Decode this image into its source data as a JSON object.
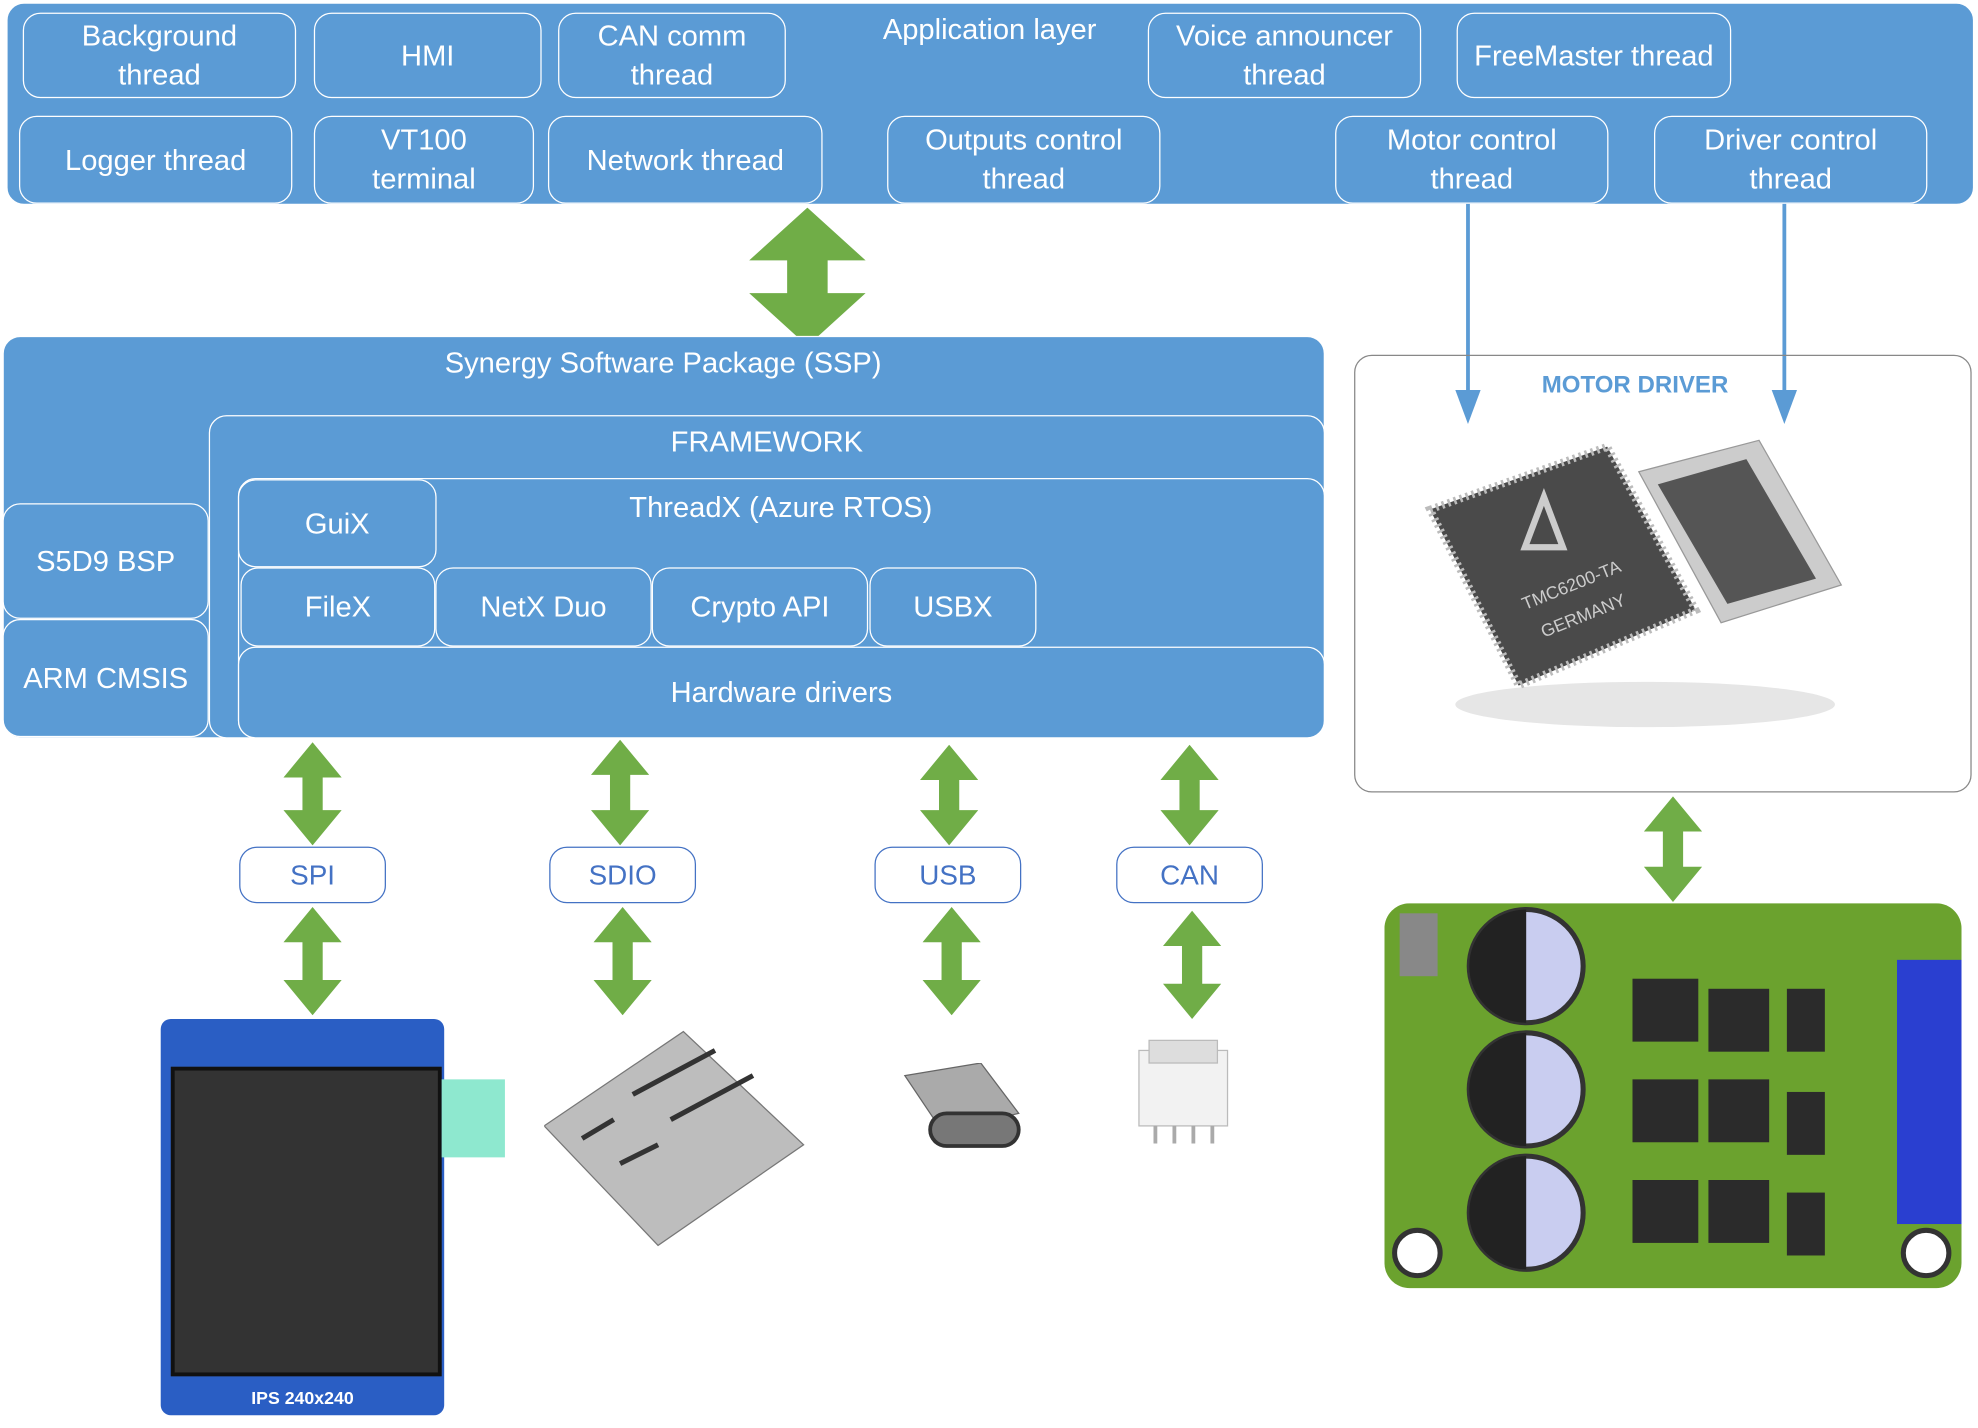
{
  "application_layer": {
    "title": "Application layer",
    "threads": [
      "Background thread",
      "HMI",
      "CAN comm thread",
      "Voice announcer thread",
      "FreeMaster thread",
      "Logger thread",
      "VT100 terminal",
      "Network thread",
      "Outputs control thread",
      "Motor control thread",
      "Driver control thread"
    ]
  },
  "ssp": {
    "title": "Synergy Software Package (SSP)",
    "framework": "FRAMEWORK",
    "rtos": "ThreadX (Azure RTOS)",
    "modules": [
      "GuiX",
      "FileX",
      "NetX Duo",
      "Crypto API",
      "USBX"
    ],
    "hardware_drivers": "Hardware drivers",
    "bsp": "S5D9 BSP",
    "cmsis": "ARM CMSIS"
  },
  "interfaces": [
    "SPI",
    "SDIO",
    "USB",
    "CAN"
  ],
  "motor_driver": {
    "title": "MOTOR DRIVER",
    "chip_text": "TMC6200-TA GERMANY"
  },
  "lcd_text": "IPS 240x240",
  "colors": {
    "block": "#5B9BD5",
    "arrow": "#70AD47",
    "pill": "#4472C4"
  }
}
